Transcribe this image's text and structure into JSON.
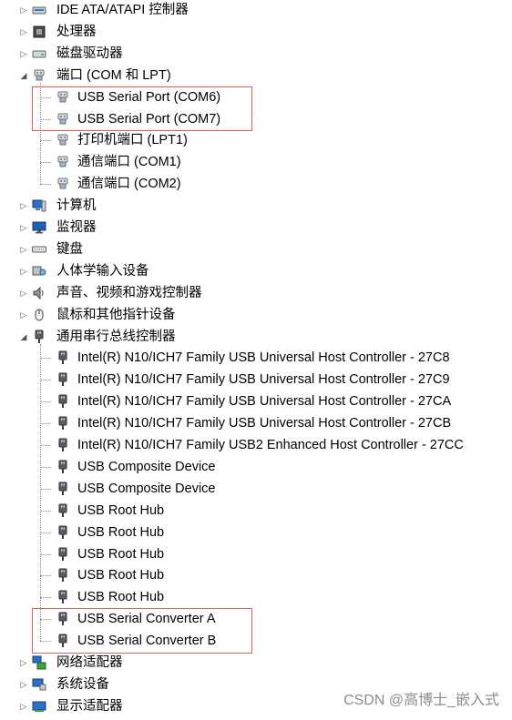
{
  "watermark": "CSDN @高博士_嵌入式",
  "colors": {
    "highlight_box": "#e05a5a",
    "tree_line": "#8a8a8a",
    "watermark": "#8c8c8c"
  },
  "tree": [
    {
      "id": "ide",
      "label": "IDE ATA/ATAPI 控制器",
      "level": 0,
      "expander": "collapsed",
      "icon": "ide-controller-icon"
    },
    {
      "id": "cpu",
      "label": "处理器",
      "level": 0,
      "expander": "collapsed",
      "icon": "processor-icon"
    },
    {
      "id": "disk",
      "label": "磁盘驱动器",
      "level": 0,
      "expander": "collapsed",
      "icon": "disk-drive-icon"
    },
    {
      "id": "ports",
      "label": "端口 (COM 和 LPT)",
      "level": 0,
      "expander": "expanded",
      "icon": "port-icon"
    },
    {
      "id": "com6",
      "label": "USB Serial Port (COM6)",
      "level": 1,
      "icon": "port-icon"
    },
    {
      "id": "com7",
      "label": "USB Serial Port (COM7)",
      "level": 1,
      "icon": "port-icon"
    },
    {
      "id": "lpt1",
      "label": "打印机端口 (LPT1)",
      "level": 1,
      "icon": "port-icon"
    },
    {
      "id": "com1",
      "label": "通信端口 (COM1)",
      "level": 1,
      "icon": "port-icon"
    },
    {
      "id": "com2",
      "label": "通信端口 (COM2)",
      "level": 1,
      "icon": "port-icon",
      "last": true
    },
    {
      "id": "computer",
      "label": "计算机",
      "level": 0,
      "expander": "collapsed",
      "icon": "computer-icon"
    },
    {
      "id": "monitor",
      "label": "监视器",
      "level": 0,
      "expander": "collapsed",
      "icon": "monitor-icon"
    },
    {
      "id": "keyboard",
      "label": "键盘",
      "level": 0,
      "expander": "collapsed",
      "icon": "keyboard-icon"
    },
    {
      "id": "hid",
      "label": "人体学输入设备",
      "level": 0,
      "expander": "collapsed",
      "icon": "hid-icon"
    },
    {
      "id": "sound",
      "label": "声音、视频和游戏控制器",
      "level": 0,
      "expander": "collapsed",
      "icon": "speaker-icon"
    },
    {
      "id": "mouse",
      "label": "鼠标和其他指针设备",
      "level": 0,
      "expander": "collapsed",
      "icon": "mouse-icon"
    },
    {
      "id": "usb",
      "label": "通用串行总线控制器",
      "level": 0,
      "expander": "expanded",
      "icon": "usb-icon"
    },
    {
      "id": "usb27c8",
      "label": "Intel(R) N10/ICH7 Family USB Universal Host Controller - 27C8",
      "level": 1,
      "icon": "usb-icon"
    },
    {
      "id": "usb27c9",
      "label": "Intel(R) N10/ICH7 Family USB Universal Host Controller - 27C9",
      "level": 1,
      "icon": "usb-icon"
    },
    {
      "id": "usb27ca",
      "label": "Intel(R) N10/ICH7 Family USB Universal Host Controller - 27CA",
      "level": 1,
      "icon": "usb-icon"
    },
    {
      "id": "usb27cb",
      "label": "Intel(R) N10/ICH7 Family USB Universal Host Controller - 27CB",
      "level": 1,
      "icon": "usb-icon"
    },
    {
      "id": "usb27cc",
      "label": "Intel(R) N10/ICH7 Family USB2 Enhanced Host Controller - 27CC",
      "level": 1,
      "icon": "usb-icon"
    },
    {
      "id": "comp1",
      "label": "USB Composite Device",
      "level": 1,
      "icon": "usb-icon"
    },
    {
      "id": "comp2",
      "label": "USB Composite Device",
      "level": 1,
      "icon": "usb-icon"
    },
    {
      "id": "hub1",
      "label": "USB Root Hub",
      "level": 1,
      "icon": "usb-icon"
    },
    {
      "id": "hub2",
      "label": "USB Root Hub",
      "level": 1,
      "icon": "usb-icon"
    },
    {
      "id": "hub3",
      "label": "USB Root Hub",
      "level": 1,
      "icon": "usb-icon"
    },
    {
      "id": "hub4",
      "label": "USB Root Hub",
      "level": 1,
      "icon": "usb-icon"
    },
    {
      "id": "hub5",
      "label": "USB Root Hub",
      "level": 1,
      "icon": "usb-icon"
    },
    {
      "id": "conva",
      "label": "USB Serial Converter A",
      "level": 1,
      "icon": "usb-icon"
    },
    {
      "id": "convb",
      "label": "USB Serial Converter B",
      "level": 1,
      "icon": "usb-icon",
      "last": true
    },
    {
      "id": "net",
      "label": "网络适配器",
      "level": 0,
      "expander": "collapsed",
      "icon": "network-icon"
    },
    {
      "id": "system",
      "label": "系统设备",
      "level": 0,
      "expander": "collapsed",
      "icon": "system-icon"
    },
    {
      "id": "display",
      "label": "显示适配器",
      "level": 0,
      "expander": "collapsed",
      "icon": "display-adapter-icon"
    }
  ],
  "highlights": [
    {
      "name": "highlight-box-com-ports",
      "from": "com6",
      "to": "com7"
    },
    {
      "name": "highlight-box-serial-converters",
      "from": "conva",
      "to": "convb"
    }
  ]
}
